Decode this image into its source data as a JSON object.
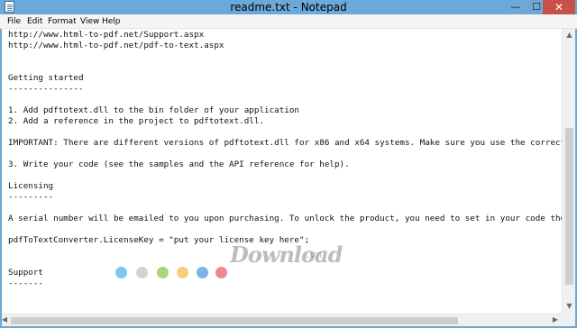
{
  "window": {
    "title": "readme.txt - Notepad",
    "controls": {
      "minimize": "—",
      "maximize": "☐",
      "close": "✕"
    }
  },
  "menu": [
    "File",
    "Edit",
    "Format",
    "View",
    "Help"
  ],
  "editor": {
    "lines": [
      "http://www.html-to-pdf.net/Support.aspx",
      "http://www.html-to-pdf.net/pdf-to-text.aspx",
      "",
      "",
      "Getting started",
      "---------------",
      "",
      "1. Add pdftotext.dll to the bin folder of your application",
      "2. Add a reference in the project to pdftotext.dll.",
      "",
      "IMPORTANT: There are different versions of pdftotext.dll for x86 and x64 systems. Make sure you use the correct ve",
      "",
      "3. Write your code (see the samples and the API reference for help).",
      "",
      "Licensing",
      "---------",
      "",
      "A serial number will be emailed to you upon purchasing. To unlock the product, you need to set in your code the se",
      "",
      "pdfToTextConverter.LicenseKey = \"put your license key here\";",
      "",
      "",
      "Support",
      "-------"
    ]
  },
  "watermark": {
    "text": "Download",
    "suffix": ".vn",
    "dot_colors": [
      "#7cc8ec",
      "#d2d2d2",
      "#a5d97c",
      "#f7ce7e",
      "#7cb4e8",
      "#ef8a8a"
    ]
  },
  "colors": {
    "titlebar": "#6ca9d8",
    "close_button": "#c7504a",
    "editor_bg": "#ffffff"
  }
}
